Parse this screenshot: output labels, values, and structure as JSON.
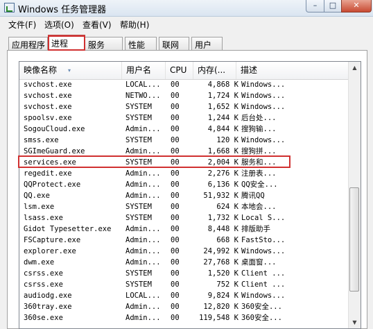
{
  "window": {
    "title": "Windows 任务管理器"
  },
  "window_buttons": {
    "minimize": "–",
    "maximize": "□",
    "close": "✕"
  },
  "menu": [
    "文件(F)",
    "选项(O)",
    "查看(V)",
    "帮助(H)"
  ],
  "tabs": [
    "应用程序",
    "进程",
    "服务",
    "性能",
    "联网",
    "用户"
  ],
  "active_tab": "进程",
  "columns": [
    "映像名称",
    "用户名",
    "CPU",
    "内存(...",
    "描述"
  ],
  "rows": [
    {
      "name": "svchost.exe",
      "user": "LOCAL...",
      "cpu": "00",
      "mem": "4,868 K",
      "desc": "Windows..."
    },
    {
      "name": "svchost.exe",
      "user": "NETWO...",
      "cpu": "00",
      "mem": "1,724 K",
      "desc": "Windows..."
    },
    {
      "name": "svchost.exe",
      "user": "SYSTEM",
      "cpu": "00",
      "mem": "1,652 K",
      "desc": "Windows..."
    },
    {
      "name": "spoolsv.exe",
      "user": "SYSTEM",
      "cpu": "00",
      "mem": "1,244 K",
      "desc": "后台处..."
    },
    {
      "name": "SogouCloud.exe",
      "user": "Admin...",
      "cpu": "00",
      "mem": "4,844 K",
      "desc": "搜狗输..."
    },
    {
      "name": "smss.exe",
      "user": "SYSTEM",
      "cpu": "00",
      "mem": "120 K",
      "desc": "Windows..."
    },
    {
      "name": "SGImeGuard.exe",
      "user": "Admin...",
      "cpu": "00",
      "mem": "1,668 K",
      "desc": "搜狗拼..."
    },
    {
      "name": "services.exe",
      "user": "SYSTEM",
      "cpu": "00",
      "mem": "2,004 K",
      "desc": "服务和..."
    },
    {
      "name": "regedit.exe",
      "user": "Admin...",
      "cpu": "00",
      "mem": "2,276 K",
      "desc": "注册表..."
    },
    {
      "name": "QQProtect.exe",
      "user": "Admin...",
      "cpu": "00",
      "mem": "6,136 K",
      "desc": "QQ安全..."
    },
    {
      "name": "QQ.exe",
      "user": "Admin...",
      "cpu": "00",
      "mem": "51,932 K",
      "desc": "腾讯QQ"
    },
    {
      "name": "lsm.exe",
      "user": "SYSTEM",
      "cpu": "00",
      "mem": "624 K",
      "desc": "本地会..."
    },
    {
      "name": "lsass.exe",
      "user": "SYSTEM",
      "cpu": "00",
      "mem": "1,732 K",
      "desc": "Local S..."
    },
    {
      "name": "Gidot Typesetter.exe",
      "user": "Admin...",
      "cpu": "00",
      "mem": "8,448 K",
      "desc": "排版助手"
    },
    {
      "name": "FSCapture.exe",
      "user": "Admin...",
      "cpu": "00",
      "mem": "668 K",
      "desc": "FastSto..."
    },
    {
      "name": "explorer.exe",
      "user": "Admin...",
      "cpu": "00",
      "mem": "24,992 K",
      "desc": "Windows..."
    },
    {
      "name": "dwm.exe",
      "user": "Admin...",
      "cpu": "00",
      "mem": "27,768 K",
      "desc": "桌面窗..."
    },
    {
      "name": "csrss.exe",
      "user": "SYSTEM",
      "cpu": "00",
      "mem": "1,520 K",
      "desc": "Client ..."
    },
    {
      "name": "csrss.exe",
      "user": "SYSTEM",
      "cpu": "00",
      "mem": "752 K",
      "desc": "Client ..."
    },
    {
      "name": "audiodg.exe",
      "user": "LOCAL...",
      "cpu": "00",
      "mem": "9,824 K",
      "desc": "Windows..."
    },
    {
      "name": "360tray.exe",
      "user": "Admin...",
      "cpu": "00",
      "mem": "12,820 K",
      "desc": "360安全..."
    },
    {
      "name": "360se.exe",
      "user": "Admin...",
      "cpu": "00",
      "mem": "119,548 K",
      "desc": "360安全..."
    }
  ],
  "selected_row": "services.exe",
  "colors": {
    "highlight_border": "#d03030",
    "titlebar": "#dae5f1"
  },
  "icons": [
    "task-manager-app-icon",
    "scroll-up-arrow-icon",
    "scroll-down-arrow-icon"
  ]
}
